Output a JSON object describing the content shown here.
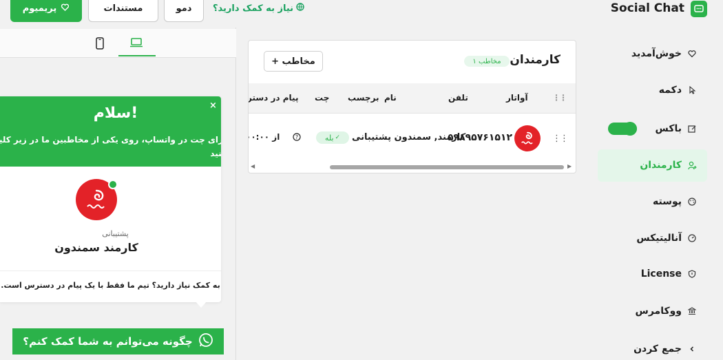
{
  "header": {
    "brand_title": "Social Chat",
    "help_link": "نیاز به کمک دارید؟",
    "demo_label": "دمو",
    "docs_label": "مستندات",
    "premium_label": "پریمیوم"
  },
  "sidebar": {
    "items": [
      {
        "label": "خوش‌آمدید",
        "icon": "heart-icon"
      },
      {
        "label": "دکمه",
        "icon": "cursor-icon"
      },
      {
        "label": "باکس",
        "icon": "edit-box-icon",
        "toggle_on": true
      },
      {
        "label": "کارمندان",
        "icon": "user-add-icon",
        "active": true
      },
      {
        "label": "پوسته",
        "icon": "palette-icon"
      },
      {
        "label": "آنالیتیکس",
        "icon": "gauge-icon"
      },
      {
        "label": "License",
        "icon": "shield-icon"
      },
      {
        "label": "ووکامرس",
        "icon": "bank-icon"
      },
      {
        "label": "جمع کردن",
        "icon": "chevron-left-icon"
      }
    ]
  },
  "card": {
    "title": "کارمندان",
    "count_badge": "۱ مخاطب",
    "add_button": "+ مخاطب",
    "columns": [
      "آواتار",
      "تلفن",
      "نام",
      "برچسب",
      "چت",
      "پیام در دستر"
    ],
    "rows": [
      {
        "phone": "۵۹۸۹۵۷۶۱۵۱۲",
        "name": "کارمند, سمندون",
        "label": "پشتیبانی",
        "chat": "بله",
        "availability": "از ۰۰:۰۰"
      }
    ]
  },
  "preview": {
    "popup_title": "سلام!",
    "popup_desc": "برای چت در واتساپ، روی یکی از مخاطبین ما در زیر کلیک کنید",
    "agent_role": "پشتیبانی",
    "agent_name": "کارمند سمندون",
    "footer_text": "به کمک نیاز دارید؟ تیم ما فقط با یک پیام در دسترس است.",
    "cta_label": "چگونه می‌توانم به شما کمک کنم؟"
  },
  "colors": {
    "brand_green": "#2bb24a",
    "avatar_red": "#e32228"
  }
}
